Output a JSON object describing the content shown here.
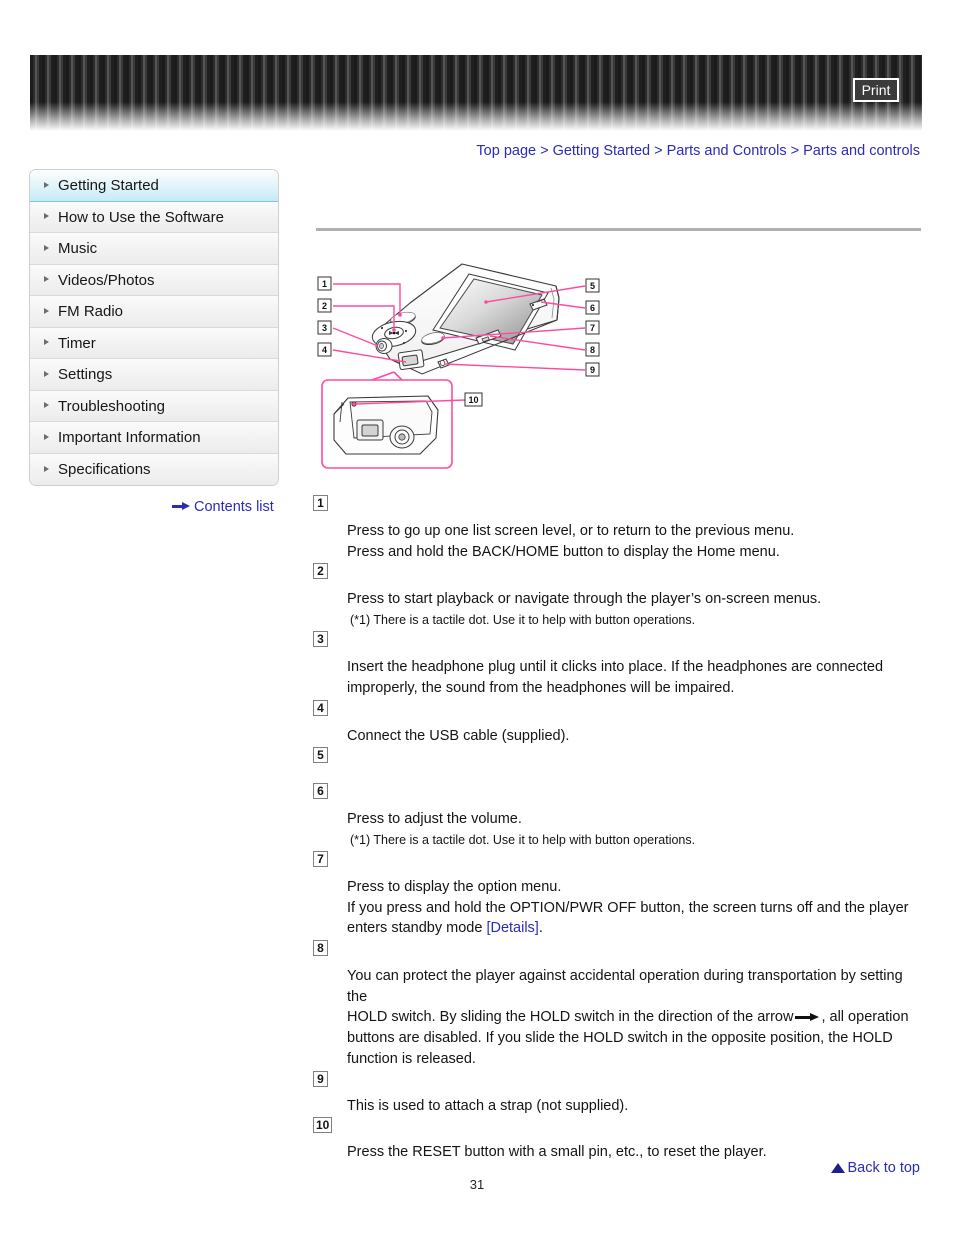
{
  "header": {
    "print_label": "Print"
  },
  "breadcrumb": {
    "items": [
      "Top page",
      "Getting Started",
      "Parts and Controls",
      "Parts and controls"
    ],
    "separator": ">"
  },
  "sidebar": {
    "items": [
      {
        "label": "Getting Started",
        "active": true
      },
      {
        "label": "How to Use the Software",
        "active": false
      },
      {
        "label": "Music",
        "active": false
      },
      {
        "label": "Videos/Photos",
        "active": false
      },
      {
        "label": "FM Radio",
        "active": false
      },
      {
        "label": "Timer",
        "active": false
      },
      {
        "label": "Settings",
        "active": false
      },
      {
        "label": "Troubleshooting",
        "active": false
      },
      {
        "label": "Important Information",
        "active": false
      },
      {
        "label": "Specifications",
        "active": false
      }
    ],
    "contents_list_label": "Contents list"
  },
  "figure": {
    "callouts": [
      "1",
      "2",
      "3",
      "4",
      "5",
      "6",
      "7",
      "8",
      "9",
      "10"
    ],
    "accent_color": "#ff4aa0",
    "description": "Line drawing of a portable media player, front/top view with callouts 1-9 and an enlarged bottom-edge inset with callout 10"
  },
  "descriptions": [
    {
      "num": "1",
      "lines": [
        "Press to go up one list screen level, or to return to the previous menu.",
        "Press and hold the BACK/HOME button to display the Home menu."
      ],
      "note": ""
    },
    {
      "num": "2",
      "lines": [
        "Press to start playback or navigate through the player’s on-screen menus."
      ],
      "note": "(*1) There is a tactile dot. Use it to help with button operations."
    },
    {
      "num": "3",
      "lines": [
        "Insert the headphone plug until it clicks into place. If the headphones are connected",
        "improperly, the sound from the headphones will be impaired."
      ],
      "note": ""
    },
    {
      "num": "4",
      "lines": [
        "Connect the USB cable (supplied)."
      ],
      "note": ""
    },
    {
      "num": "5",
      "lines": [],
      "note": ""
    },
    {
      "num": "6",
      "lines": [
        "Press to adjust the volume."
      ],
      "note": "(*1) There is a tactile dot. Use it to help with button operations."
    },
    {
      "num": "7",
      "lines": [
        "Press to display the option menu.",
        "If you press and hold the OPTION/PWR OFF button, the screen turns off and the player"
      ],
      "tail_prefix": "enters standby mode ",
      "link_label": "[Details]",
      "tail_suffix": ".",
      "note": ""
    },
    {
      "num": "8",
      "lines": [
        "You can protect the player against accidental operation during transportation by setting the"
      ],
      "arrow_line_prefix": "HOLD switch. By sliding the HOLD switch in the direction of the arrow",
      "arrow_line_suffix": ", all operation",
      "lines_after": [
        "buttons are disabled. If you slide the HOLD switch in the opposite position, the HOLD",
        "function is released."
      ],
      "note": ""
    },
    {
      "num": "9",
      "lines": [
        "This is used to attach a strap (not supplied)."
      ],
      "note": ""
    },
    {
      "num": "10",
      "lines": [
        "Press the RESET button with a small pin, etc., to reset the player."
      ],
      "note": ""
    }
  ],
  "footer": {
    "back_to_top_label": "Back to top",
    "page_number": "31"
  }
}
